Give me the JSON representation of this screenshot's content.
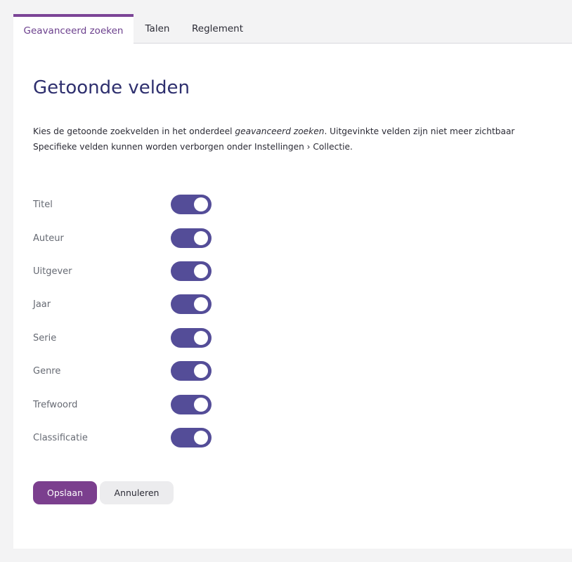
{
  "tabs": [
    {
      "label": "Geavanceerd zoeken",
      "active": true
    },
    {
      "label": "Talen",
      "active": false
    },
    {
      "label": "Reglement",
      "active": false
    }
  ],
  "page": {
    "title": "Getoonde velden",
    "desc_line1_a": "Kies de getoonde zoekvelden in het onderdeel ",
    "desc_line1_em": "geavanceerd zoeken",
    "desc_line1_b": ". Uitgevinkte velden zijn niet meer zichtbaar",
    "desc_line2": "Specifieke velden kunnen worden verborgen onder Instellingen › Collectie."
  },
  "fields": [
    {
      "label": "Titel",
      "enabled": true
    },
    {
      "label": "Auteur",
      "enabled": true
    },
    {
      "label": "Uitgever",
      "enabled": true
    },
    {
      "label": "Jaar",
      "enabled": true
    },
    {
      "label": "Serie",
      "enabled": true
    },
    {
      "label": "Genre",
      "enabled": true
    },
    {
      "label": "Trefwoord",
      "enabled": true
    },
    {
      "label": "Classificatie",
      "enabled": true
    }
  ],
  "actions": {
    "save_label": "Opslaan",
    "cancel_label": "Annuleren"
  },
  "colors": {
    "accent": "#7b3f8e",
    "toggle_on": "#544d98",
    "title": "#2e2f6e"
  }
}
